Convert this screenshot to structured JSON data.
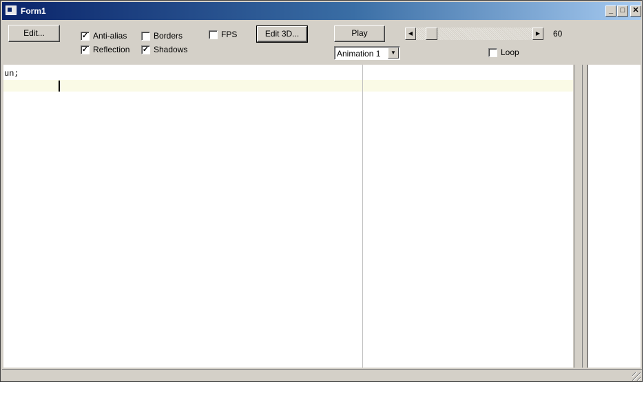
{
  "window": {
    "title": "Form1",
    "controls": {
      "minimize": "_",
      "maximize": "□",
      "close": "✕"
    }
  },
  "toolbar": {
    "edit_button": "Edit...",
    "checkboxes": {
      "anti_alias": {
        "label": "Anti-alias",
        "checked": true,
        "mark": "✓"
      },
      "reflection": {
        "label": "Reflection",
        "checked": true,
        "mark": "✓"
      },
      "borders": {
        "label": "Borders",
        "checked": false,
        "mark": ""
      },
      "shadows": {
        "label": "Shadows",
        "checked": true,
        "mark": "✓"
      },
      "fps": {
        "label": "FPS",
        "checked": false,
        "mark": ""
      },
      "loop": {
        "label": "Loop",
        "checked": false,
        "mark": ""
      }
    },
    "edit3d_button": "Edit 3D...",
    "play_button": "Play",
    "animation_select": {
      "selected": "Animation 1",
      "arrow": "▼"
    },
    "slider": {
      "left_arrow": "◀",
      "right_arrow": "▶",
      "value": "60"
    }
  },
  "editor": {
    "lines": [
      "",
      "un;",
      ""
    ]
  },
  "icons": {
    "app": "form-window-icon",
    "grip": "resize-grip-icon"
  }
}
